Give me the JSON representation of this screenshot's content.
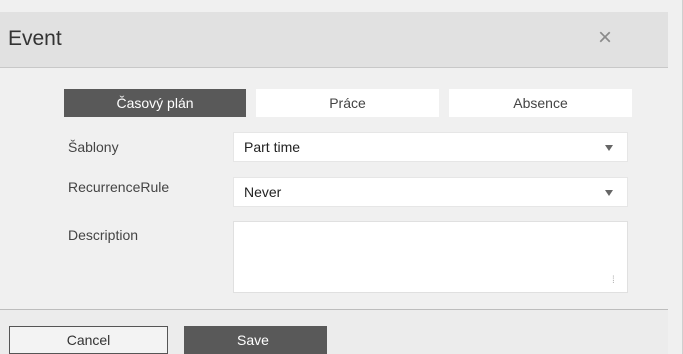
{
  "dialog": {
    "title": "Event",
    "close_glyph": "×",
    "close_icon": "close-icon"
  },
  "tabs": [
    {
      "label": "Časový plán",
      "active": true
    },
    {
      "label": "Práce",
      "active": false
    },
    {
      "label": "Absence",
      "active": false
    }
  ],
  "form": {
    "templates_label": "Šablony",
    "templates_value": "Part time",
    "recurrence_label": "RecurrenceRule",
    "recurrence_value": "Never",
    "description_label": "Description",
    "description_value": ""
  },
  "footer": {
    "cancel_label": "Cancel",
    "save_label": "Save"
  },
  "colors": {
    "active_tab": "#595959",
    "header_bg": "#e1e1e1",
    "body_bg": "#f0f0f0"
  }
}
